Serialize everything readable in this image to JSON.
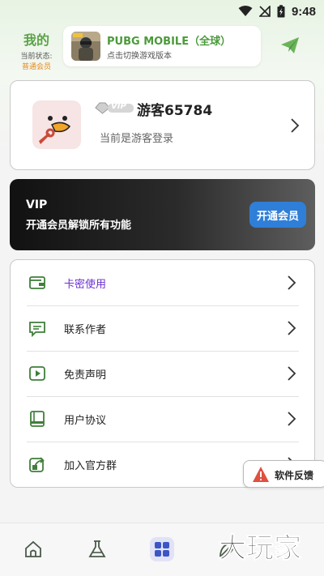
{
  "status_bar": {
    "time": "9:48"
  },
  "header": {
    "me_title": "我的",
    "status_label": "当前状态:",
    "status_value": "普通会员"
  },
  "game": {
    "name": "PUBG MOBILE（全球）",
    "subtitle": "点击切换游戏版本"
  },
  "profile": {
    "vip_badge": "VIP",
    "name": "游客65784",
    "login_state": "当前是游客登录"
  },
  "vip_card": {
    "title": "VIP",
    "description": "开通会员解锁所有功能",
    "button": "开通会员"
  },
  "menu": {
    "items": [
      {
        "label": "卡密使用",
        "icon": "wallet-icon",
        "color": "#6a2fd0"
      },
      {
        "label": "联系作者",
        "icon": "message-icon",
        "color": "#222222"
      },
      {
        "label": "免责声明",
        "icon": "play-icon",
        "color": "#222222"
      },
      {
        "label": "用户协议",
        "icon": "book-icon",
        "color": "#222222"
      },
      {
        "label": "加入官方群",
        "icon": "share-icon",
        "color": "#222222"
      }
    ]
  },
  "feedback": {
    "label": "软件反馈"
  },
  "bottom_nav": {
    "items": [
      {
        "icon": "home-icon",
        "active": false
      },
      {
        "icon": "flask-icon",
        "active": false
      },
      {
        "icon": "grid-icon",
        "active": true
      },
      {
        "icon": "leaf-icon",
        "active": false
      }
    ]
  },
  "watermark": {
    "text": "大玩家"
  },
  "colors": {
    "accent_green": "#5aa347",
    "member_orange": "#e2891f",
    "vip_button_blue": "#2f7fd8",
    "active_purple": "#6a2fd0",
    "icon_green": "#3f7f3a",
    "warning_red": "#e0503f"
  }
}
